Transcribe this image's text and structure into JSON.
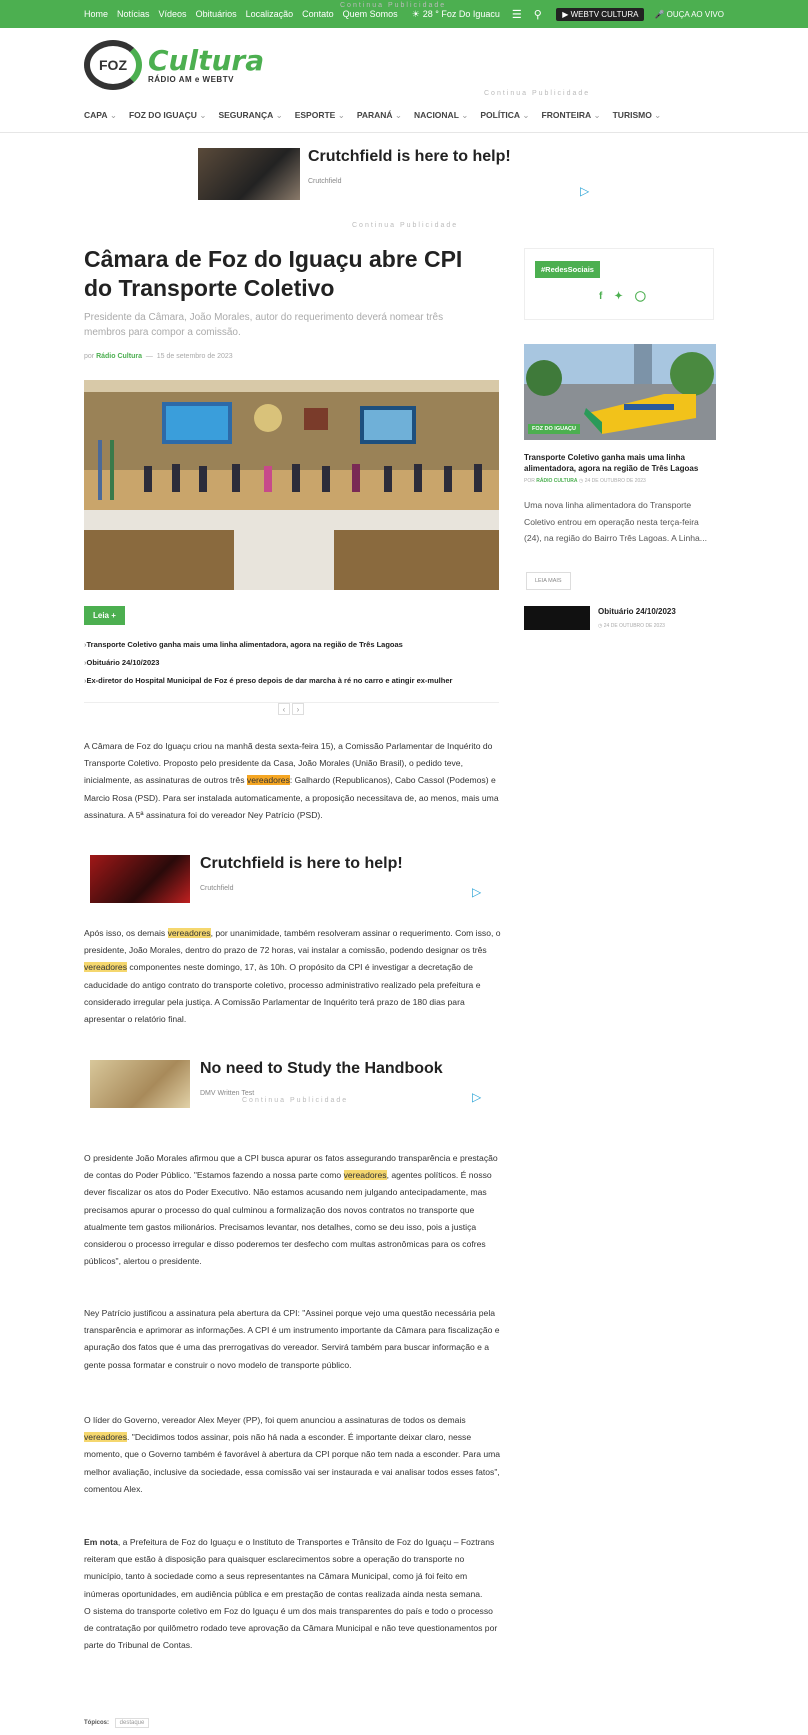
{
  "topbar": {
    "nav": [
      "Home",
      "Notícias",
      "Vídeos",
      "Obituários",
      "Localização",
      "Contato",
      "Quem Somos"
    ],
    "weather": "28 °  Foz Do Iguacu",
    "webtv": "WEBTV CULTURA",
    "live": "OUÇA AO VIVO"
  },
  "logo": {
    "brand": "Cultura",
    "tagline": "RÁDIO AM e WEBTV",
    "mark": "FOZ"
  },
  "ad_label": "Continua Publicidade",
  "mainnav": [
    "CAPA",
    "FOZ DO IGUAÇU",
    "SEGURANÇA",
    "ESPORTE",
    "PARANÁ",
    "NACIONAL",
    "POLÍTICA",
    "FRONTEIRA",
    "TURISMO"
  ],
  "ad1": {
    "title": "Crutchfield is here to help!",
    "source": "Crutchfield"
  },
  "article": {
    "title": "Câmara de Foz do Iguaçu abre CPI do Transporte Coletivo",
    "subtitle": "Presidente da Câmara, João Morales, autor do requerimento deverá nomear três membros para compor a comissão.",
    "by_prefix": "por",
    "author": "Rádio Cultura",
    "date": "15 de setembro de 2023",
    "leia": "Leia +",
    "related": [
      "Transporte Coletivo ganha mais uma linha alimentadora, agora na região de Três Lagoas",
      "Obituário 24/10/2023",
      "Ex-diretor do Hospital Municipal de Foz é preso depois de dar marcha à ré no carro e atingir ex-mulher"
    ],
    "p1a": "A Câmara de Foz do Iguaçu criou na manhã desta sexta-feira 15), a Comissão Parlamentar de Inquérito do Transporte Coletivo. Proposto pelo presidente da Casa, João Morales (União Brasil), o pedido teve, inicialmente, as assinaturas de outros três",
    "kw": "vereadores",
    "p1b": ": Galhardo (Republicanos), Cabo Cassol (Podemos) e Marcio Rosa (PSD). Para ser instalada automaticamente, a proposição necessitava de, ao menos, mais uma assinatura. A 5ª assinatura foi do vereador Ney Patrício (PSD).",
    "p2a": "Após isso, os demais",
    "p2b": ", por unanimidade, também resolveram assinar o requerimento. Com isso, o presidente, João Morales, dentro do prazo de 72 horas, vai instalar a comissão, podendo designar os três",
    "p2c": " componentes neste domingo, 17, às 10h. O propósito da CPI é investigar a decretação de caducidade do antigo contrato do transporte coletivo, processo administrativo realizado pela prefeitura e considerado irregular pela justiça. A Comissão Parlamentar de Inquérito terá prazo de 180 dias para apresentar o relatório final.",
    "p3a": "O presidente João Morales afirmou que a CPI busca apurar os fatos assegurando transparência e prestação de contas do Poder Público. \"Estamos fazendo a nossa parte como",
    "p3b": ", agentes políticos. É nosso dever fiscalizar os atos do Poder Executivo. Não estamos acusando nem julgando antecipadamente, mas precisamos apurar o processo do qual culminou a formalização dos novos contratos no transporte que atualmente tem gastos milionários. Precisamos levantar, nos detalhes, como se deu isso, pois a justiça considerou o processo irregular e disso poderemos ter desfecho com multas astronômicas para os cofres públicos\", alertou o presidente.",
    "p4": "Ney Patrício justificou a assinatura pela abertura da CPI: \"Assinei porque vejo uma questão necessária pela transparência e aprimorar as informações. A CPI é um instrumento importante da Câmara para fiscalização e apuração dos fatos que é uma das prerrogativas do vereador. Servirá também para buscar informação e a gente possa formatar e construir o novo modelo de transporte público.",
    "p5a": "O líder do Governo, vereador Alex Meyer (PP), foi quem anunciou a assinaturas de todos os demais",
    "p5b": ". \"Decidimos todos assinar, pois não há nada a esconder. É importante deixar claro, nesse momento, que o Governo também é favorável à abertura da CPI porque não tem nada a esconder. Para uma melhor avaliação, inclusive da sociedade, essa comissão vai ser instaurada e vai analisar todos esses fatos\", comentou Alex.",
    "p6_bold": "Em nota",
    "p6": ", a Prefeitura de Foz do Iguaçu e o Instituto de Transportes e Trânsito de Foz do Iguaçu – Foztrans reiteram que estão à disposição para quaisquer esclarecimentos sobre a operação do transporte no município, tanto à sociedade como a seus representantes na Câmara Municipal, como já foi feito em inúmeras oportunidades, em audiência pública e em prestação de contas realizada ainda nesta semana.",
    "p7": "O sistema do transporte coletivo em Foz do Iguaçu é um dos mais transparentes do país e todo o processo de contratação por quilômetro rodado teve aprovação da Câmara Municipal e não teve questionamentos por parte do Tribunal de Contas.",
    "topics_label": "Tópicos:",
    "topic": "destaque"
  },
  "ad2": {
    "title": "Crutchfield is here to help!",
    "source": "Crutchfield"
  },
  "ad3": {
    "title": "No need to Study the Handbook",
    "source": "DMV Written Test"
  },
  "sidebar": {
    "tag": "#RedesSociais",
    "badge": "FOZ DO IGUAÇU",
    "headline": "Transporte Coletivo ganha mais uma linha alimentadora, agora na região de Três Lagoas",
    "meta_prefix": "POR",
    "meta_author": "RÁDIO CULTURA",
    "meta_date": "24 DE OUTUBRO DE 2023",
    "excerpt": "Uma nova linha alimentadora do Transporte Coletivo entrou em operação nesta terça-feira (24), na região do Bairro Três Lagoas. A Linha...",
    "read_more": "LEIA MAIS",
    "obit_title": "Obituário 24/10/2023",
    "obit_date": "24 DE OUTUBRO DE 2023"
  }
}
